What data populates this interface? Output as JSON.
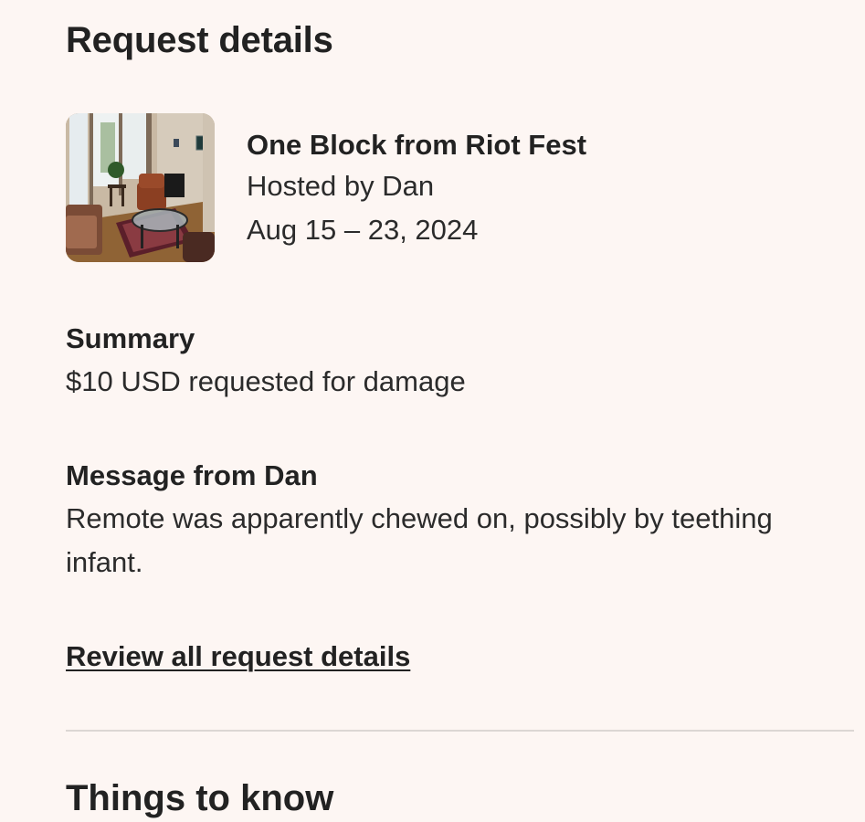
{
  "page": {
    "section_title": "Request details",
    "next_section_title": "Things to know"
  },
  "listing": {
    "image_icon": "listing-photo",
    "name": "One Block from Riot Fest",
    "host": "Hosted by Dan",
    "dates": "Aug 15 – 23, 2024"
  },
  "summary": {
    "label": "Summary",
    "text": "$10 USD requested for damage"
  },
  "message": {
    "label": "Message from Dan",
    "text": "Remote was apparently chewed on, possibly by teething infant."
  },
  "actions": {
    "review_link": "Review all request details"
  },
  "colors": {
    "background": "#fdf6f3",
    "text": "#222222",
    "divider": "#dcd6d3"
  }
}
